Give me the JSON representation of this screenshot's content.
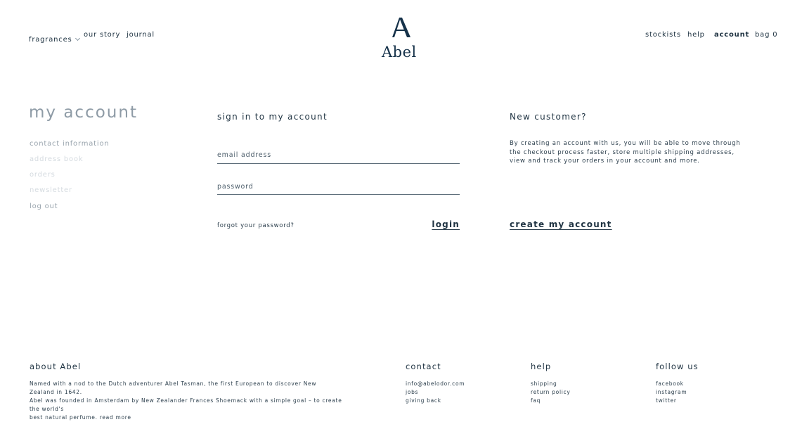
{
  "header": {
    "nav_left": [
      "fragrances",
      "our story",
      "journal"
    ],
    "logo_text": "Abel",
    "nav_right": [
      "stockists",
      "help",
      "account",
      "bag 0"
    ]
  },
  "sidebar": {
    "title": "my account",
    "items": [
      "contact information",
      "address book",
      "orders",
      "newsletter",
      "log out"
    ]
  },
  "signin": {
    "title": "sign in to my account",
    "email_label": "email address",
    "password_label": "password",
    "forgot_label": "forgot your password?",
    "login_label": "login"
  },
  "new_customer": {
    "title": "New customer?",
    "line1": "By creating an account with us, you will be able to move through",
    "line2": "the checkout process faster, store multiple shipping addresses,",
    "line3": "view and track your orders in your account and more.",
    "cta_label": "create my account"
  },
  "footer": {
    "about_title": "about Abel",
    "about_line1": "Named with a nod to the Dutch adventurer Abel Tasman, the first European to discover New Zealand in 1642.",
    "about_line2": "Abel was founded in Amsterdam by New Zealander Frances Shoemack with a simple goal – to create the world's",
    "about_line3": "best natural perfume. read more",
    "contact_title": "contact",
    "contact_items": [
      "info@abelodor.com",
      "jobs",
      "giving back"
    ],
    "help_title": "help",
    "help_items": [
      "shipping",
      "return policy",
      "faq"
    ],
    "follow_title": "follow us",
    "follow_items": [
      "facebook",
      "instagram",
      "twitter"
    ]
  },
  "colors": {
    "navy": "#1f3342",
    "muted_grey": "#9aa5ae",
    "faint_grey": "#d5dbe0"
  },
  "icons": [
    "chevron-down-icon",
    "abel-logo-mark"
  ]
}
